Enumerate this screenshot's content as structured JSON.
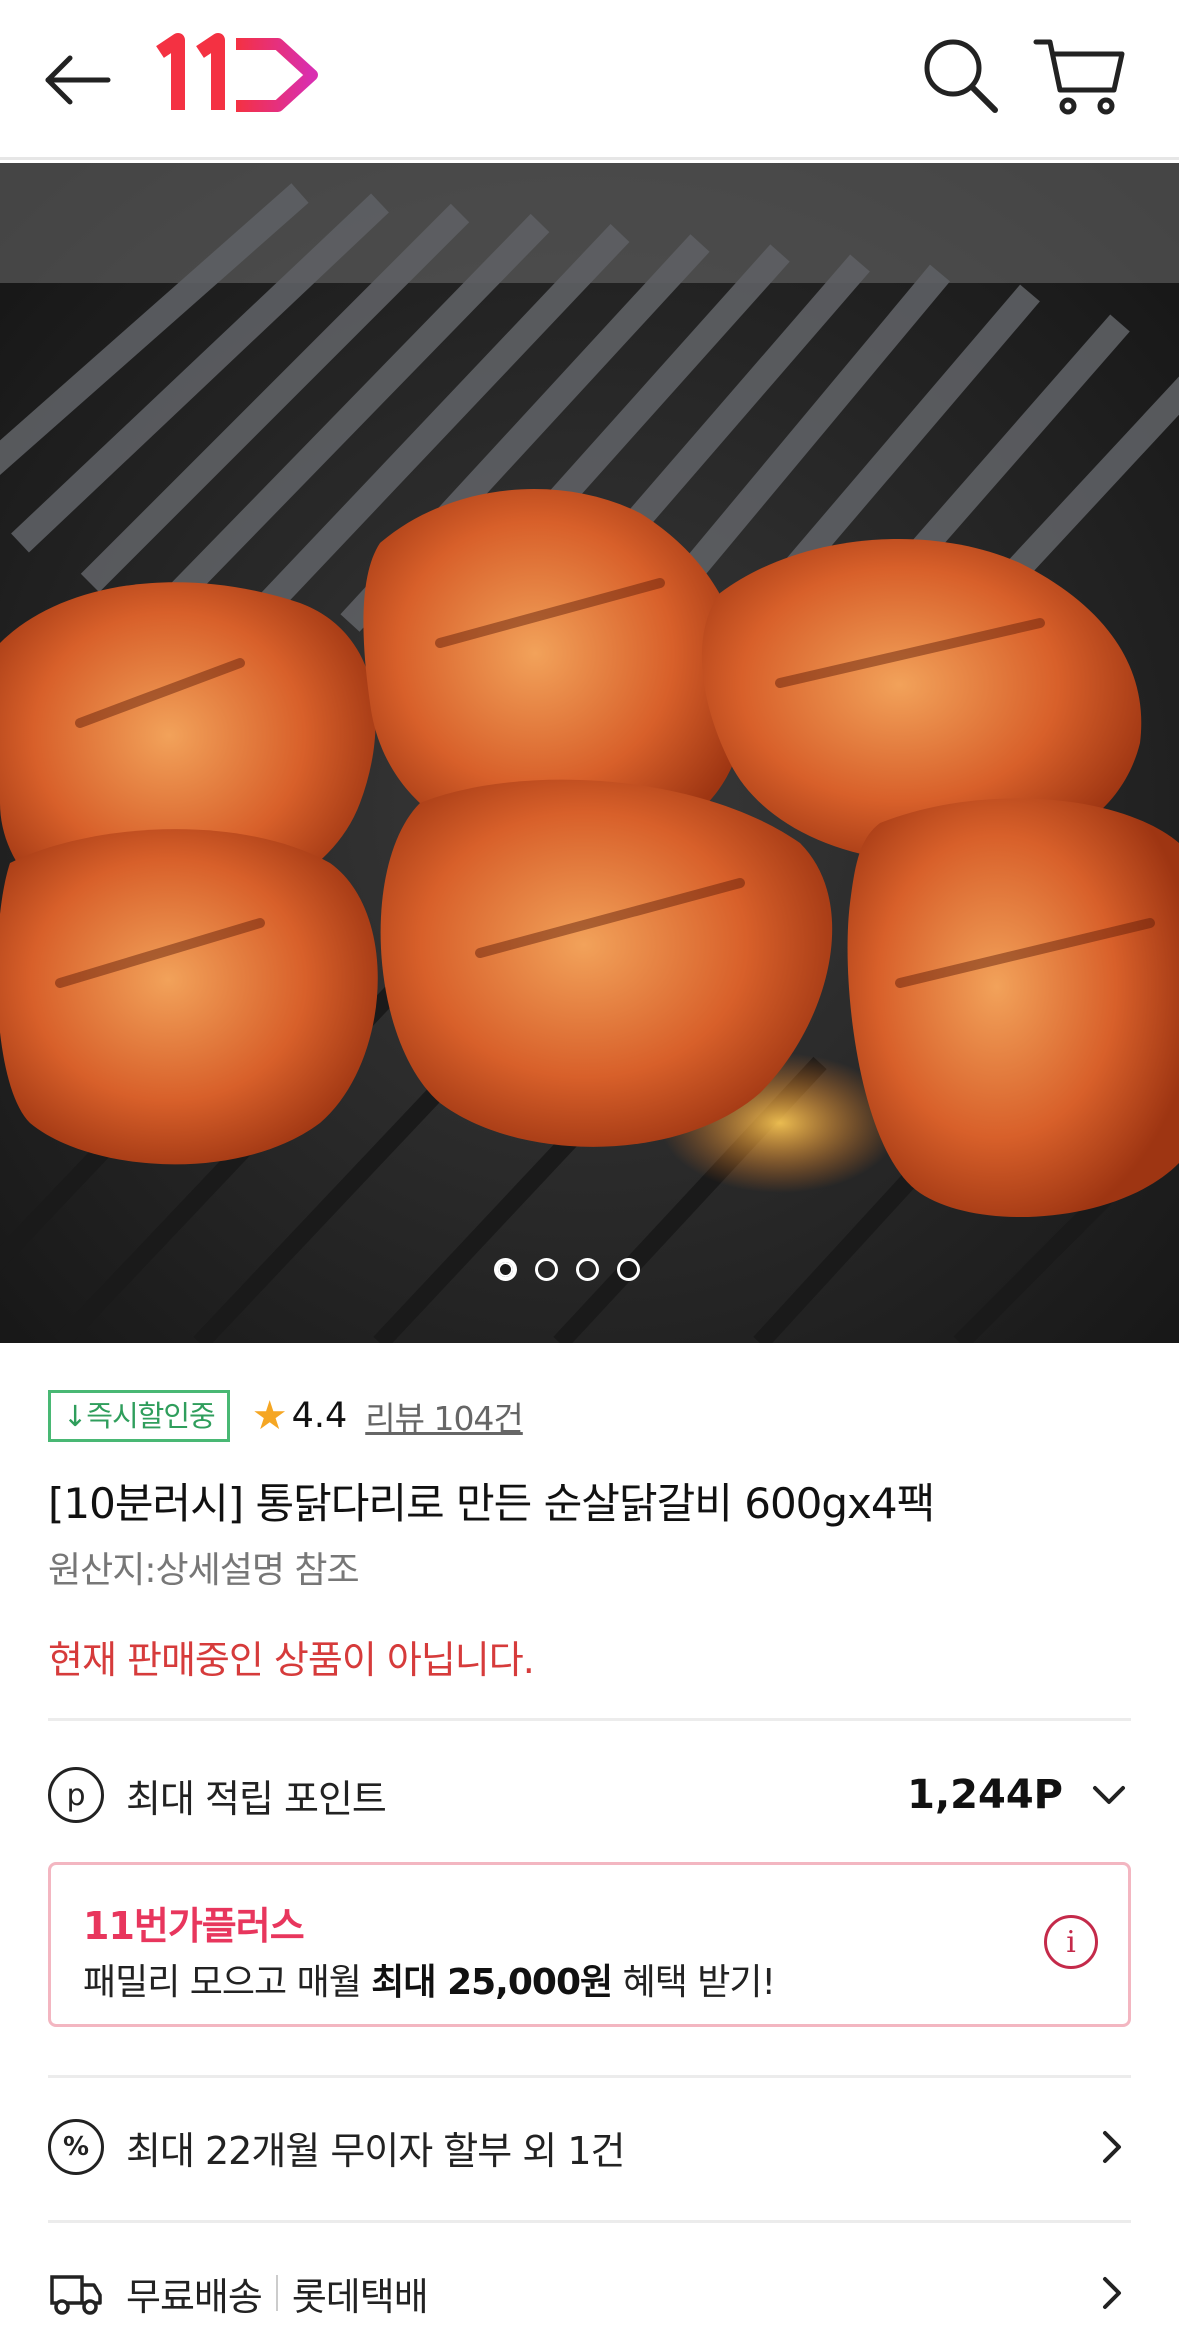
{
  "header": {
    "back_icon": "arrow-left-icon",
    "logo_text": "11",
    "logo_colors": [
      "#f43142",
      "#e02a88"
    ],
    "search_icon": "search-icon",
    "cart_icon": "cart-icon"
  },
  "hero": {
    "image": "grilled-chicken-photo",
    "slide_count": 4,
    "active_slide": 1
  },
  "product": {
    "discount_badge": "↓즉시할인중",
    "rating_icon": "star-icon",
    "rating": "4.4",
    "review_link": "리뷰 104건",
    "title": "[10분러시] 통닭다리로 만든 순살닭갈비 600gx4팩",
    "origin": "원산지:상세설명 참조",
    "status": "현재 판매중인 상품이 아닙니다."
  },
  "points": {
    "icon_letter": "p",
    "label": "최대 적립 포인트",
    "value": "1,244P"
  },
  "plus_banner": {
    "title": "11번가플러스",
    "desc_prefix": "패밀리 모으고 매월 ",
    "desc_bold": "최대 25,000원",
    "desc_suffix": " 혜택 받기!",
    "info_icon": "i"
  },
  "installment": {
    "icon_text": "%",
    "label": "최대 22개월 무이자 할부 외 1건"
  },
  "delivery": {
    "label": "무료배송",
    "carrier": "롯데택배"
  },
  "colors": {
    "accent_red": "#d63b3b",
    "badge_green": "#49b874",
    "plus_pink": "#e8365d",
    "star": "#f5a623"
  }
}
